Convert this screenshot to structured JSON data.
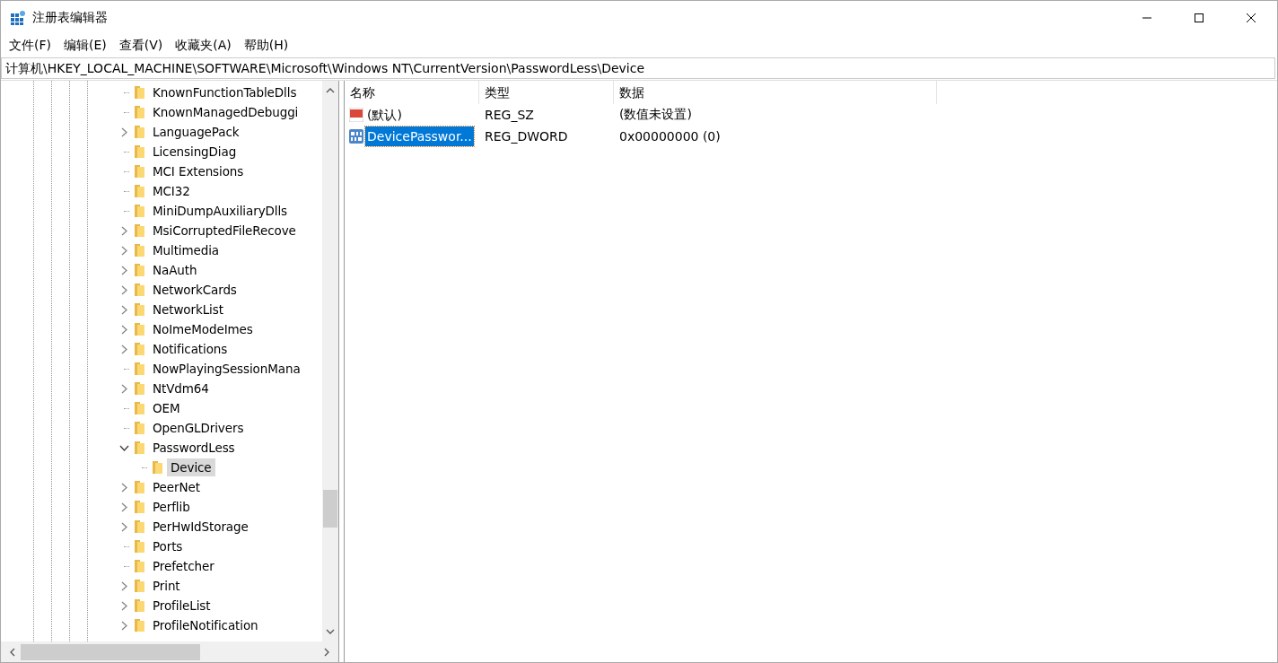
{
  "window": {
    "title": "注册表编辑器"
  },
  "menu": [
    {
      "label": "文件(F)"
    },
    {
      "label": "编辑(E)"
    },
    {
      "label": "查看(V)"
    },
    {
      "label": "收藏夹(A)"
    },
    {
      "label": "帮助(H)"
    }
  ],
  "address": {
    "value": "计算机\\HKEY_LOCAL_MACHINE\\SOFTWARE\\Microsoft\\Windows NT\\CurrentVersion\\PasswordLess\\Device"
  },
  "tree": [
    {
      "label": "KnownFunctionTableDlls",
      "kind": "leaf",
      "selected": false
    },
    {
      "label": "KnownManagedDebuggi",
      "kind": "leaf",
      "selected": false
    },
    {
      "label": "LanguagePack",
      "kind": "collapsed",
      "selected": false
    },
    {
      "label": "LicensingDiag",
      "kind": "leaf",
      "selected": false
    },
    {
      "label": "MCI Extensions",
      "kind": "leaf",
      "selected": false
    },
    {
      "label": "MCI32",
      "kind": "leaf",
      "selected": false
    },
    {
      "label": "MiniDumpAuxiliaryDlls",
      "kind": "leaf",
      "selected": false
    },
    {
      "label": "MsiCorruptedFileRecove",
      "kind": "collapsed",
      "selected": false
    },
    {
      "label": "Multimedia",
      "kind": "collapsed",
      "selected": false
    },
    {
      "label": "NaAuth",
      "kind": "collapsed",
      "selected": false
    },
    {
      "label": "NetworkCards",
      "kind": "collapsed",
      "selected": false
    },
    {
      "label": "NetworkList",
      "kind": "collapsed",
      "selected": false
    },
    {
      "label": "NoImeModeImes",
      "kind": "collapsed",
      "selected": false
    },
    {
      "label": "Notifications",
      "kind": "collapsed",
      "selected": false
    },
    {
      "label": "NowPlayingSessionMana",
      "kind": "leaf",
      "selected": false
    },
    {
      "label": "NtVdm64",
      "kind": "collapsed",
      "selected": false
    },
    {
      "label": "OEM",
      "kind": "leaf",
      "selected": false
    },
    {
      "label": "OpenGLDrivers",
      "kind": "leaf",
      "selected": false
    },
    {
      "label": "PasswordLess",
      "kind": "expanded",
      "selected": false,
      "children": [
        {
          "label": "Device",
          "kind": "leaf",
          "selected": true
        }
      ]
    },
    {
      "label": "PeerNet",
      "kind": "collapsed",
      "selected": false
    },
    {
      "label": "Perflib",
      "kind": "collapsed",
      "selected": false
    },
    {
      "label": "PerHwIdStorage",
      "kind": "collapsed",
      "selected": false
    },
    {
      "label": "Ports",
      "kind": "leaf",
      "selected": false
    },
    {
      "label": "Prefetcher",
      "kind": "leaf",
      "selected": false
    },
    {
      "label": "Print",
      "kind": "collapsed",
      "selected": false
    },
    {
      "label": "ProfileList",
      "kind": "collapsed",
      "selected": false
    },
    {
      "label": "ProfileNotification",
      "kind": "collapsed",
      "selected": false
    }
  ],
  "table": {
    "columns": [
      "名称",
      "类型",
      "数据"
    ],
    "rows": [
      {
        "name": "(默认)",
        "type": "REG_SZ",
        "data": "(数值未设置)",
        "kind": "string",
        "selected": false
      },
      {
        "name": "DevicePasswor...",
        "type": "REG_DWORD",
        "data": "0x00000000 (0)",
        "kind": "binary",
        "selected": true
      }
    ]
  }
}
